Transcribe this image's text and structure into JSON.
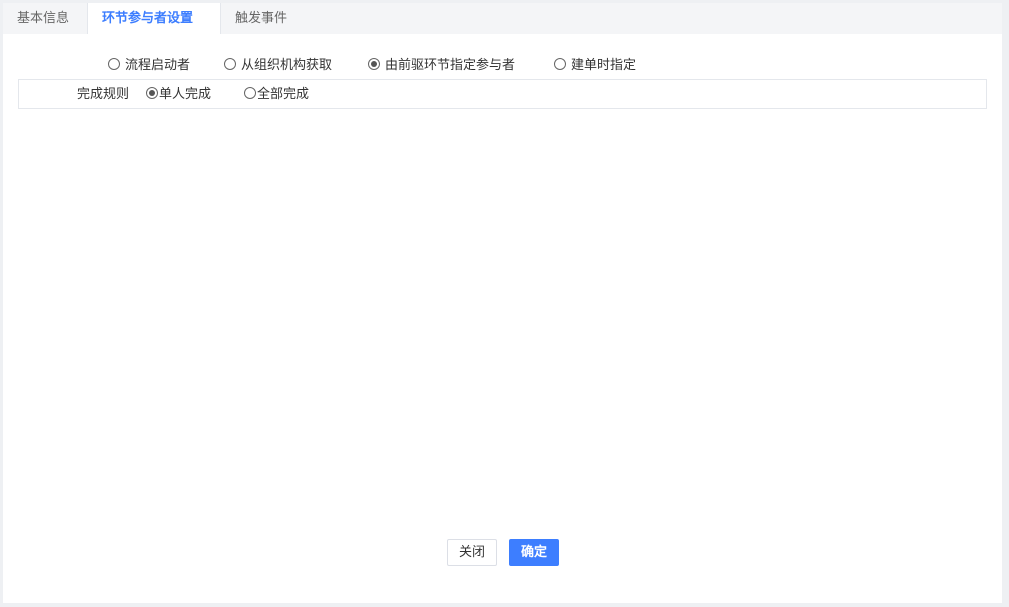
{
  "tabs": [
    {
      "label": "基本信息",
      "active": false
    },
    {
      "label": "环节参与者设置",
      "active": true
    },
    {
      "label": "触发事件",
      "active": false
    }
  ],
  "participant_source": {
    "options": [
      {
        "label": "流程启动者",
        "checked": false
      },
      {
        "label": "从组织机构获取",
        "checked": false
      },
      {
        "label": "由前驱环节指定参与者",
        "checked": true
      },
      {
        "label": "建单时指定",
        "checked": false
      }
    ]
  },
  "completion_rule": {
    "title": "完成规则",
    "options": [
      {
        "label": "单人完成",
        "checked": true
      },
      {
        "label": "全部完成",
        "checked": false
      }
    ]
  },
  "buttons": {
    "close_label": "关闭",
    "confirm_label": "确定"
  },
  "colors": {
    "accent": "#3d7eff",
    "page_background": "#eef0f3",
    "tab_bar": "#f4f5f7",
    "border": "#e4e7ec"
  }
}
